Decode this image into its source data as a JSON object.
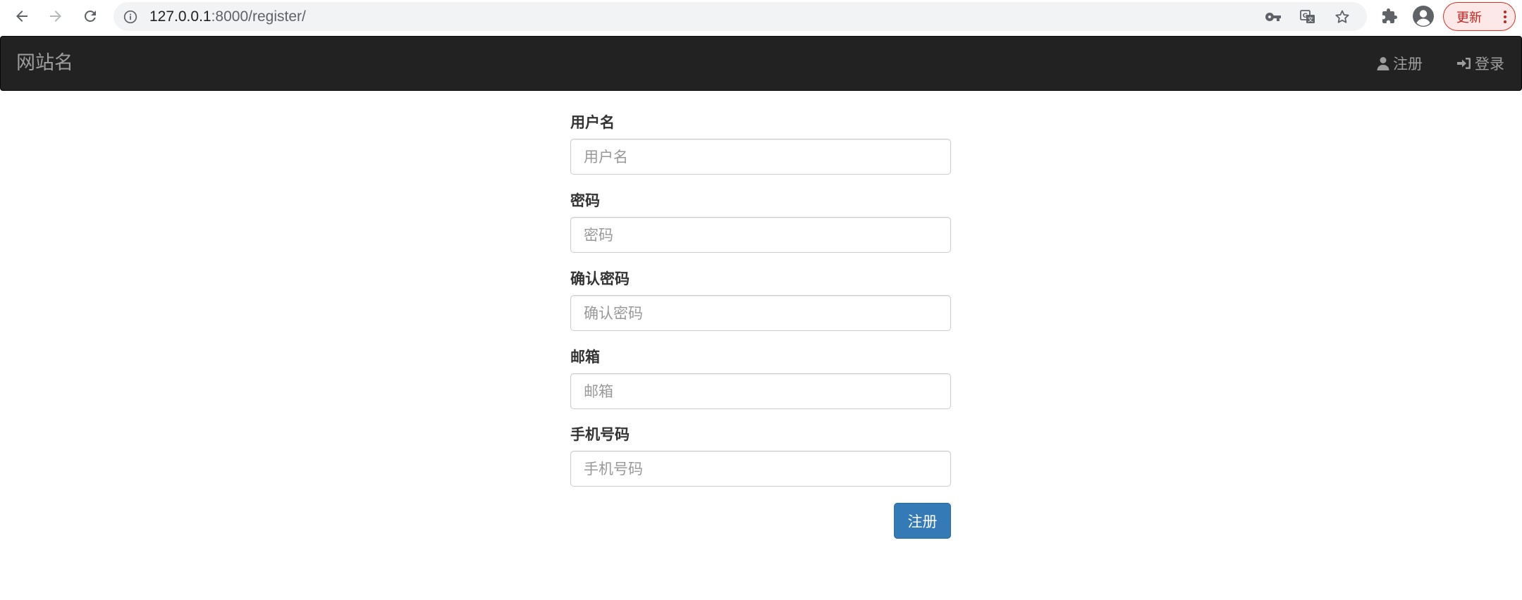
{
  "browser": {
    "url_host": "127.0.0.1",
    "url_rest": ":8000/register/",
    "update_label": "更新",
    "icons": [
      "back-icon",
      "forward-icon",
      "reload-icon",
      "info-icon",
      "key-icon",
      "translate-icon",
      "star-icon",
      "extensions-icon",
      "profile-icon",
      "kebab-menu-icon"
    ]
  },
  "navbar": {
    "brand": "网站名",
    "register_label": "注册",
    "login_label": "登录",
    "background": "#222222",
    "text_color": "#9d9d9d"
  },
  "form": {
    "username": {
      "label": "用户名",
      "placeholder": "用户名",
      "value": ""
    },
    "password": {
      "label": "密码",
      "placeholder": "密码",
      "value": ""
    },
    "confirm_password": {
      "label": "确认密码",
      "placeholder": "确认密码",
      "value": ""
    },
    "email": {
      "label": "邮箱",
      "placeholder": "邮箱",
      "value": ""
    },
    "phone": {
      "label": "手机号码",
      "placeholder": "手机号码",
      "value": ""
    },
    "submit_label": "注册",
    "submit_color": "#337ab7"
  }
}
